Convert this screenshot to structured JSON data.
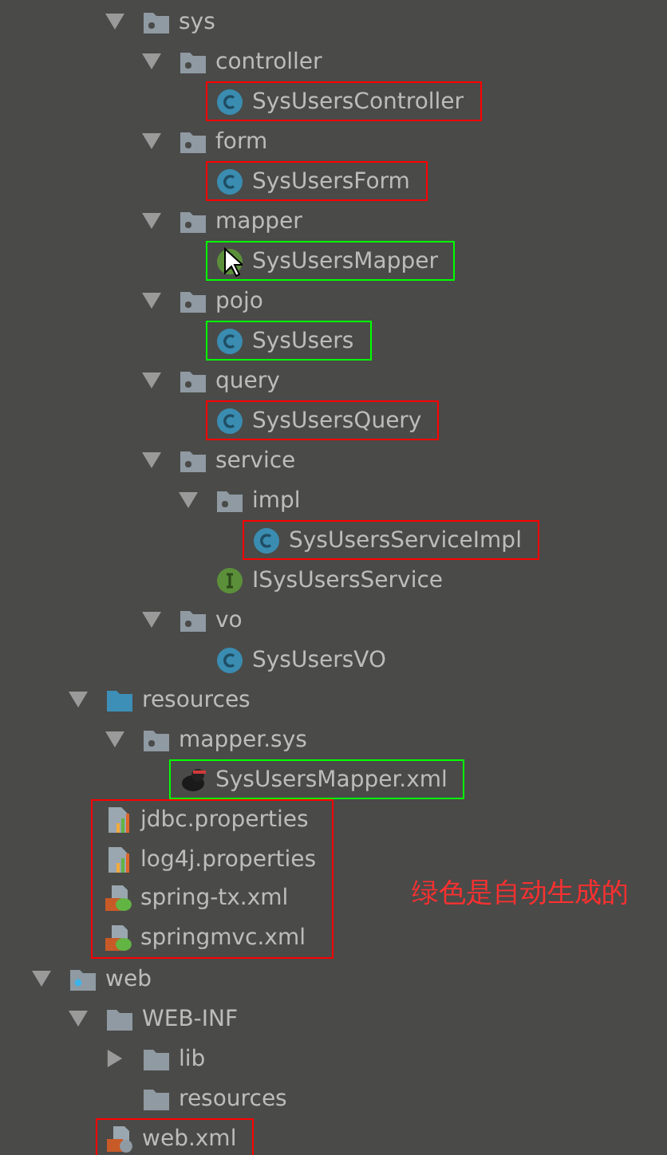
{
  "tree": [
    {
      "kind": "package",
      "label": "sys",
      "expanded": true,
      "children": [
        {
          "kind": "package",
          "label": "controller",
          "expanded": true,
          "children": [
            {
              "kind": "class",
              "label": "SysUsersController",
              "color": "#ff0000"
            }
          ]
        },
        {
          "kind": "package",
          "label": "form",
          "expanded": true,
          "children": [
            {
              "kind": "class",
              "label": "SysUsersForm",
              "color": "#ff0000"
            }
          ]
        },
        {
          "kind": "package",
          "label": "mapper",
          "expanded": true,
          "children": [
            {
              "kind": "interface",
              "label": "SysUsersMapper",
              "color": "#00ff00",
              "pointer": true
            }
          ]
        },
        {
          "kind": "package",
          "label": "pojo",
          "expanded": true,
          "children": [
            {
              "kind": "class",
              "label": "SysUsers",
              "color": "#00ff00"
            }
          ]
        },
        {
          "kind": "package",
          "label": "query",
          "expanded": true,
          "children": [
            {
              "kind": "class",
              "label": "SysUsersQuery",
              "color": "#ff0000"
            }
          ]
        },
        {
          "kind": "package",
          "label": "service",
          "expanded": true,
          "children": [
            {
              "kind": "package",
              "label": "impl",
              "expanded": true,
              "children": [
                {
                  "kind": "class",
                  "label": "SysUsersServiceImpl",
                  "color": "#ff0000"
                }
              ]
            },
            {
              "kind": "interface",
              "label": "ISysUsersService"
            }
          ]
        },
        {
          "kind": "package",
          "label": "vo",
          "expanded": true,
          "children": [
            {
              "kind": "class",
              "label": "SysUsersVO"
            }
          ]
        }
      ]
    }
  ],
  "resources": {
    "kind": "resources",
    "label": "resources",
    "expanded": true,
    "children": [
      {
        "kind": "package",
        "label": "mapper.sys",
        "expanded": true,
        "children": [
          {
            "kind": "mybatis",
            "label": "SysUsersMapper.xml",
            "color": "#00ff00"
          }
        ]
      },
      {
        "kind": "group",
        "color": "#ff0000",
        "children": [
          {
            "kind": "properties",
            "label": "jdbc.properties"
          },
          {
            "kind": "properties",
            "label": "log4j.properties"
          },
          {
            "kind": "spring",
            "label": "spring-tx.xml"
          },
          {
            "kind": "spring",
            "label": "springmvc.xml"
          }
        ]
      }
    ]
  },
  "web": {
    "kind": "web",
    "label": "web",
    "expanded": true,
    "children": [
      {
        "kind": "folder",
        "label": "WEB-INF",
        "expanded": true,
        "children": [
          {
            "kind": "folder",
            "label": "lib",
            "expanded": false
          },
          {
            "kind": "folder",
            "label": "resources"
          }
        ]
      },
      {
        "kind": "webxml",
        "label": "web.xml",
        "color": "#ff0000"
      }
    ]
  },
  "note": {
    "text": "绿色是自动生成的",
    "color": "#ff3030"
  }
}
